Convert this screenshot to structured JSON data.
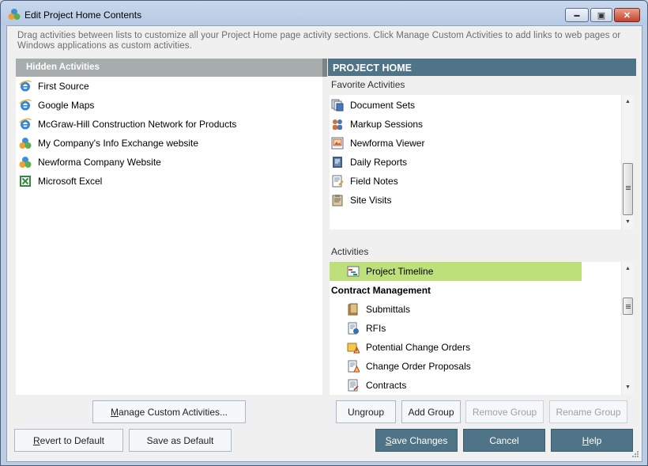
{
  "window": {
    "title": "Edit Project Home Contents",
    "minimize_label": "▬",
    "maximize_label": "▣",
    "close_label": "✕"
  },
  "instructions": "Drag activities between lists to customize all your Project Home page activity sections.  Click Manage Custom Activities to add links to web pages or Windows applications as custom activities.",
  "hidden": {
    "header": "Hidden Activities",
    "items": [
      {
        "label": "First Source",
        "icon": "ie-icon"
      },
      {
        "label": "Google Maps",
        "icon": "ie-icon"
      },
      {
        "label": "McGraw-Hill Construction Network for Products",
        "icon": "ie-icon"
      },
      {
        "label": "My Company's Info Exchange website",
        "icon": "newforma-logo-icon"
      },
      {
        "label": "Newforma Company Website",
        "icon": "newforma-logo-icon"
      },
      {
        "label": "Microsoft Excel",
        "icon": "excel-icon"
      }
    ]
  },
  "project_home": {
    "header": "PROJECT HOME",
    "favorites_label": "Favorite Activities",
    "favorites": [
      {
        "label": "Document Sets",
        "icon": "document-sets-icon"
      },
      {
        "label": "Markup Sessions",
        "icon": "markup-sessions-icon"
      },
      {
        "label": "Newforma Viewer",
        "icon": "viewer-icon"
      },
      {
        "label": "Daily Reports",
        "icon": "daily-reports-icon"
      },
      {
        "label": "Field Notes",
        "icon": "field-notes-icon"
      },
      {
        "label": "Site Visits",
        "icon": "site-visits-icon"
      }
    ],
    "activities_label": "Activities",
    "activities": {
      "selected": {
        "label": "Project Timeline",
        "icon": "timeline-icon"
      },
      "group_title": "Contract Management",
      "items": [
        {
          "label": "Submittals",
          "icon": "submittals-icon"
        },
        {
          "label": "RFIs",
          "icon": "rfis-icon"
        },
        {
          "label": "Potential Change Orders",
          "icon": "potential-change-orders-icon"
        },
        {
          "label": "Change Order Proposals",
          "icon": "change-order-proposals-icon"
        },
        {
          "label": "Contracts",
          "icon": "contracts-icon"
        }
      ]
    }
  },
  "buttons": {
    "manage_custom_pre": "",
    "manage_custom_key": "M",
    "manage_custom_post": "anage Custom Activities...",
    "ungroup": "Ungroup",
    "add_group": "Add Group",
    "remove_group": "Remove Group",
    "rename_group": "Rename Group",
    "revert_key": "R",
    "revert_post": "evert to Default",
    "save_default": "Save as Default",
    "save_changes_key": "S",
    "save_changes_post": "ave Changes",
    "cancel": "Cancel",
    "help_key": "H",
    "help_post": "elp"
  },
  "colors": {
    "accent": "#4f7387",
    "selection": "#bee07a",
    "hidden_header": "#a7acad"
  }
}
